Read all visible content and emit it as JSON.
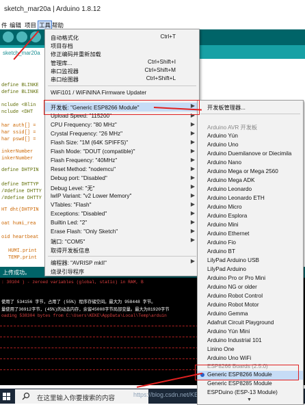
{
  "window": {
    "title": "sketch_mar20a | Arduino 1.8.12"
  },
  "menubar": [
    "件",
    "编辑",
    "项目",
    "工具",
    "帮助"
  ],
  "tab": {
    "label": "sketch_mar20a"
  },
  "code_lines": [
    "define BLINKE",
    "define BLINKE",
    "nclude <Blin",
    "nclude <DHT",
    "har auth[] =",
    "har ssid[] =",
    "har pswd[] =",
    "inkerNumber",
    "inkerNumber",
    "define DHTPIN",
    "define DHTTYP",
    "/#define DHTTY",
    "/#define DHTTY",
    "HT dht(DHTPIN",
    "oat humi_rea",
    "oid heartbeat",
    "HUMI.print",
    "TEMP.print"
  ],
  "status_bar": {
    "text": "上传成功。"
  },
  "console_lines": [
    ": 30104 )      - zeroed variables        (global, static) in RAM, B",
    "使用了 534156 字节，占用了 (55%) 程序存储空间。最大为 958448 字节。",
    "量使用了36912字节，(45%)的动态内存，余留45008字节局部变量。最大为81920字节",
    "oading 538304 bytes from C:\\Users\\KEKE\\AppData\\Local\\Temp\\arduin"
  ],
  "tools_menu": {
    "items": [
      {
        "label": "自动格式化",
        "shortcut": "Ctrl+T"
      },
      {
        "label": "项目存档",
        "shortcut": ""
      },
      {
        "label": "修正编码并重新加载",
        "shortcut": ""
      },
      {
        "label": "管理库...",
        "shortcut": "Ctrl+Shift+I"
      },
      {
        "label": "串口监视器",
        "shortcut": "Ctrl+Shift+M"
      },
      {
        "label": "串口绘图器",
        "shortcut": "Ctrl+Shift+L"
      },
      {
        "label": "WiFi101 / WiFiNINA Firmware Updater",
        "shortcut": ""
      },
      {
        "label": "开发板: \"Generic ESP8266 Module\"",
        "shortcut": ""
      },
      {
        "label": "Upload Speed: \"115200\"",
        "shortcut": ""
      },
      {
        "label": "CPU Frequency: \"80 MHz\"",
        "shortcut": ""
      },
      {
        "label": "Crystal Frequency: \"26 MHz\"",
        "shortcut": ""
      },
      {
        "label": "Flash Size: \"1M (64K SPIFFS)\"",
        "shortcut": ""
      },
      {
        "label": "Flash Mode: \"DOUT (compatible)\"",
        "shortcut": ""
      },
      {
        "label": "Flash Frequency: \"40MHz\"",
        "shortcut": ""
      },
      {
        "label": "Reset Method: \"nodemcu\"",
        "shortcut": ""
      },
      {
        "label": "Debug port: \"Disabled\"",
        "shortcut": ""
      },
      {
        "label": "Debug Level: \"无\"",
        "shortcut": ""
      },
      {
        "label": "lwIP Variant: \"v2 Lower Memory\"",
        "shortcut": ""
      },
      {
        "label": "VTables: \"Flash\"",
        "shortcut": ""
      },
      {
        "label": "Exceptions: \"Disabled\"",
        "shortcut": ""
      },
      {
        "label": "Builtin Led: \"2\"",
        "shortcut": ""
      },
      {
        "label": "Erase Flash: \"Only Sketch\"",
        "shortcut": ""
      },
      {
        "label": "端口: \"COM5\"",
        "shortcut": ""
      },
      {
        "label": "取得开发板信息",
        "shortcut": ""
      },
      {
        "label": "编程器: \"AVRISP mkII\"",
        "shortcut": ""
      },
      {
        "label": "烧录引导程序",
        "shortcut": ""
      }
    ]
  },
  "boards_menu": {
    "manager": "开发板管理器...",
    "avr_header": "Arduino AVR 开发板",
    "boards": [
      "Arduino Yún",
      "Arduino Uno",
      "Arduino Duemilanove or Diecimila",
      "Arduino Nano",
      "Arduino Mega or Mega 2560",
      "Arduino Mega ADK",
      "Arduino Leonardo",
      "Arduino Leonardo ETH",
      "Arduino Micro",
      "Arduino Esplora",
      "Arduino Mini",
      "Arduino Ethernet",
      "Arduino Fio",
      "Arduino BT",
      "LilyPad Arduino USB",
      "LilyPad Arduino",
      "Arduino Pro or Pro Mini",
      "Arduino NG or older",
      "Arduino Robot Control",
      "Arduino Robot Motor",
      "Arduino Gemma",
      "Adafruit Circuit Playground",
      "Arduino Yún Mini",
      "Arduino Industrial 101",
      "Linino One",
      "Arduino Uno WiFi"
    ],
    "esp_header": "ESP8266 Boards (2.5.0)",
    "esp_boards": [
      "Generic ESP8266 Module",
      "Generic ESP8285 Module",
      "ESPDuino (ESP-13 Module)"
    ]
  },
  "taskbar": {
    "search_placeholder": "在这里输入你要搜索的内容"
  },
  "watermark": "https://blog.csdn.net/KEKEGH",
  "colors": {
    "arduino_teal": "#006468",
    "tab_teal": "#17a1a5",
    "highlight": "#c6dcf6",
    "annotation_red": "#e02020"
  }
}
